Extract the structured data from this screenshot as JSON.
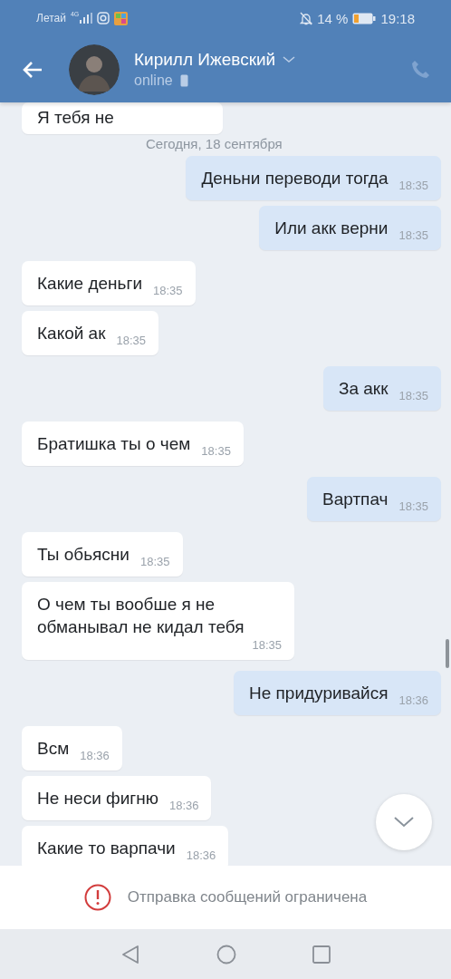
{
  "status_bar": {
    "carrier": "Летай",
    "network": "4G",
    "battery": "14 %",
    "time": "19:18"
  },
  "header": {
    "name": "Кирилл Ижевский",
    "status": "online"
  },
  "messages": [
    {
      "kind": "incoming",
      "text": "Я  тебя не"
    },
    {
      "kind": "date",
      "text": "Сегодня, 18 сентября"
    },
    {
      "kind": "outgoing",
      "text": "Деньни переводи тогда",
      "time": "18:35"
    },
    {
      "kind": "outgoing",
      "text": "Или акк верни",
      "time": "18:35"
    },
    {
      "kind": "incoming",
      "text": "Какие деньги",
      "time": "18:35"
    },
    {
      "kind": "incoming",
      "text": "Какой ак",
      "time": "18:35"
    },
    {
      "kind": "outgoing",
      "text": "За акк",
      "time": "18:35"
    },
    {
      "kind": "incoming",
      "text": "Братишка ты о чем",
      "time": "18:35"
    },
    {
      "kind": "outgoing",
      "text": "Вартпач",
      "time": "18:35"
    },
    {
      "kind": "incoming",
      "text": "Ты обьясни",
      "time": "18:35"
    },
    {
      "kind": "incoming",
      "text": "О чем ты вообше я не обманывал не кидал тебя",
      "time": "18:35"
    },
    {
      "kind": "outgoing",
      "text": "Не придуривайся",
      "time": "18:36"
    },
    {
      "kind": "incoming",
      "text": "Всм",
      "time": "18:36"
    },
    {
      "kind": "incoming",
      "text": "Не неси фигню",
      "time": "18:36"
    },
    {
      "kind": "incoming",
      "text": "Какие то варпачи",
      "time": "18:36"
    }
  ],
  "notice": "Отправка сообщений ограничена"
}
